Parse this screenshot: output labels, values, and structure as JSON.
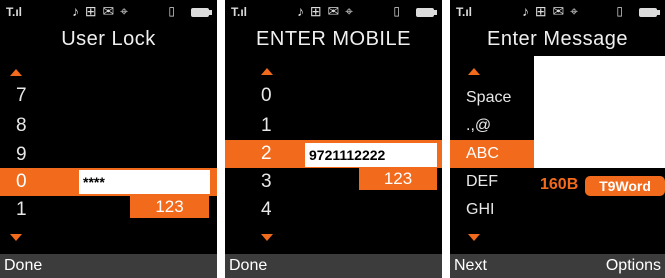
{
  "status": {
    "signal": "T.ıl",
    "apps": "♪ ⊞ ✉ ⌖",
    "lock": "▯"
  },
  "colors": {
    "accent": "#f26a1b",
    "background": "#000000",
    "softkey_bar": "#3c3c3c"
  },
  "screens": [
    {
      "title": "User Lock",
      "items": [
        "7",
        "8",
        "9",
        "0",
        "1"
      ],
      "selected_index": 3,
      "input_value": "****",
      "mode": "123",
      "softkey_left": "Done"
    },
    {
      "title": "ENTER MOBILE",
      "items": [
        "0",
        "1",
        "2",
        "3",
        "4"
      ],
      "selected_index": 2,
      "input_value": "9721112222",
      "mode": "123",
      "softkey_left": "Done"
    },
    {
      "title": "Enter Message",
      "items": [
        "Space",
        ".,@",
        "ABC",
        "DEF",
        "GHI"
      ],
      "selected_index": 2,
      "counter": "160B",
      "input_mode": "T9Word",
      "softkey_left": "Next",
      "softkey_right": "Options"
    }
  ]
}
